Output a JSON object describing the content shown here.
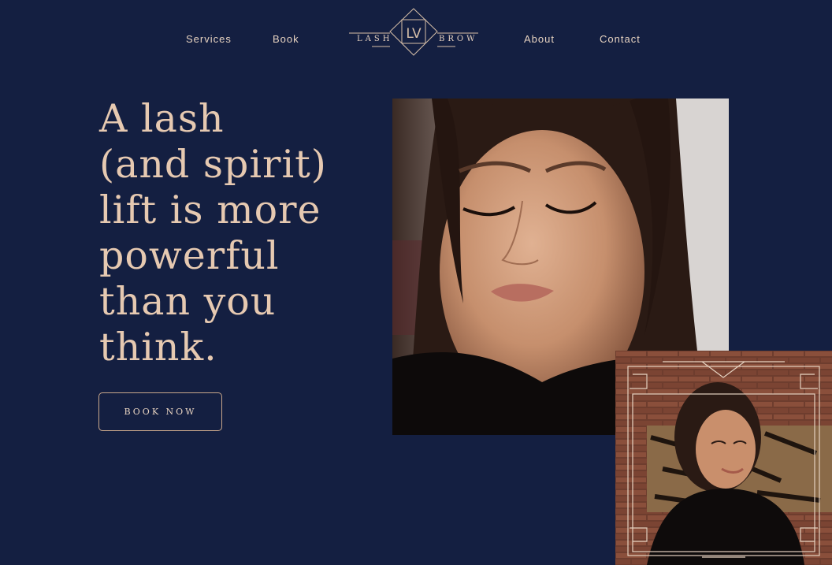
{
  "nav": {
    "services": "Services",
    "book": "Book",
    "about": "About",
    "contact": "Contact"
  },
  "logo": {
    "monogram": "LV",
    "left_word": "LASH",
    "right_word": "BROW"
  },
  "hero": {
    "headline": [
      "A lash",
      "(and spirit)",
      "lift is more",
      "powerful",
      "than you",
      "think."
    ],
    "cta_label": "BOOK NOW"
  },
  "colors": {
    "background": "#141f41",
    "accent": "#e6c9b1",
    "border": "#c9a78b"
  }
}
